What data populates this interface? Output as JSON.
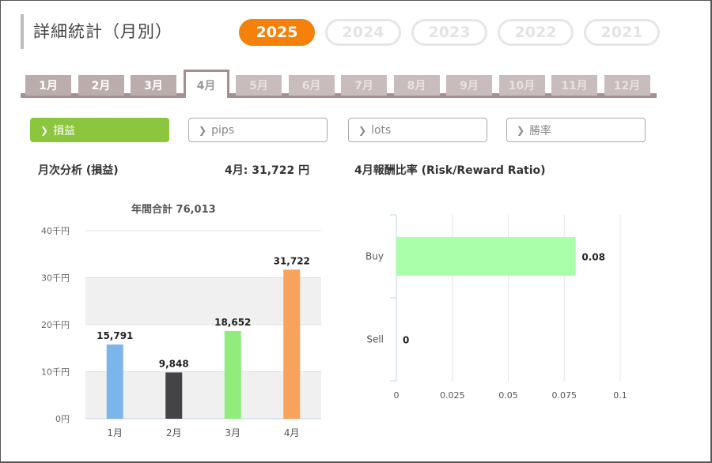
{
  "page": {
    "title": "詳細統計（月別）",
    "years": [
      {
        "label": "2025",
        "active": true
      },
      {
        "label": "2024",
        "active": false
      },
      {
        "label": "2023",
        "active": false
      },
      {
        "label": "2022",
        "active": false
      },
      {
        "label": "2021",
        "active": false
      }
    ],
    "months": [
      {
        "label": "1月",
        "state": "enabled"
      },
      {
        "label": "2月",
        "state": "enabled"
      },
      {
        "label": "3月",
        "state": "enabled"
      },
      {
        "label": "4月",
        "state": "active"
      },
      {
        "label": "5月",
        "state": "disabled"
      },
      {
        "label": "6月",
        "state": "disabled"
      },
      {
        "label": "7月",
        "state": "disabled"
      },
      {
        "label": "8月",
        "state": "disabled"
      },
      {
        "label": "9月",
        "state": "disabled"
      },
      {
        "label": "10月",
        "state": "disabled"
      },
      {
        "label": "11月",
        "state": "disabled"
      },
      {
        "label": "12月",
        "state": "disabled"
      }
    ],
    "metrics": [
      {
        "label": "損益",
        "active": true
      },
      {
        "label": "pips",
        "active": false
      },
      {
        "label": "lots",
        "active": false
      },
      {
        "label": "勝率",
        "active": false
      }
    ],
    "monthly_heading": "月次分析 (損益)",
    "monthly_value": "4月:  31,722 円",
    "ratio_heading": "4月報酬比率 (Risk/Reward Ratio)",
    "colors": {
      "accent": "#f5800a",
      "metric_active": "#8cc63f",
      "tab": "#bcadad",
      "tab_border": "#a58f8f"
    }
  },
  "chart_data": [
    {
      "type": "bar",
      "title": "年間合計 76,013",
      "categories": [
        "1月",
        "2月",
        "3月",
        "4月"
      ],
      "values": [
        15791,
        9848,
        18652,
        31722
      ],
      "value_labels": [
        "15,791",
        "9,848",
        "18,652",
        "31,722"
      ],
      "colors": [
        "#7cb5ec",
        "#434348",
        "#90ed7d",
        "#f7a35c"
      ],
      "ylim": [
        0,
        40000
      ],
      "yticks": [
        0,
        10000,
        20000,
        30000,
        40000
      ],
      "ytick_labels": [
        "0円",
        "10千円",
        "20千円",
        "30千円",
        "40千円"
      ],
      "grid": "alternating bands"
    },
    {
      "type": "bar",
      "orientation": "horizontal",
      "categories": [
        "Buy",
        "Sell"
      ],
      "values": [
        0.08,
        0
      ],
      "value_labels": [
        "0.08",
        "0"
      ],
      "color": "#aaffaa",
      "xlim": [
        0,
        0.1
      ],
      "xticks": [
        0,
        0.025,
        0.05,
        0.075,
        0.1
      ],
      "xtick_labels": [
        "0",
        "0.025",
        "0.05",
        "0.075",
        "0.1"
      ]
    }
  ]
}
